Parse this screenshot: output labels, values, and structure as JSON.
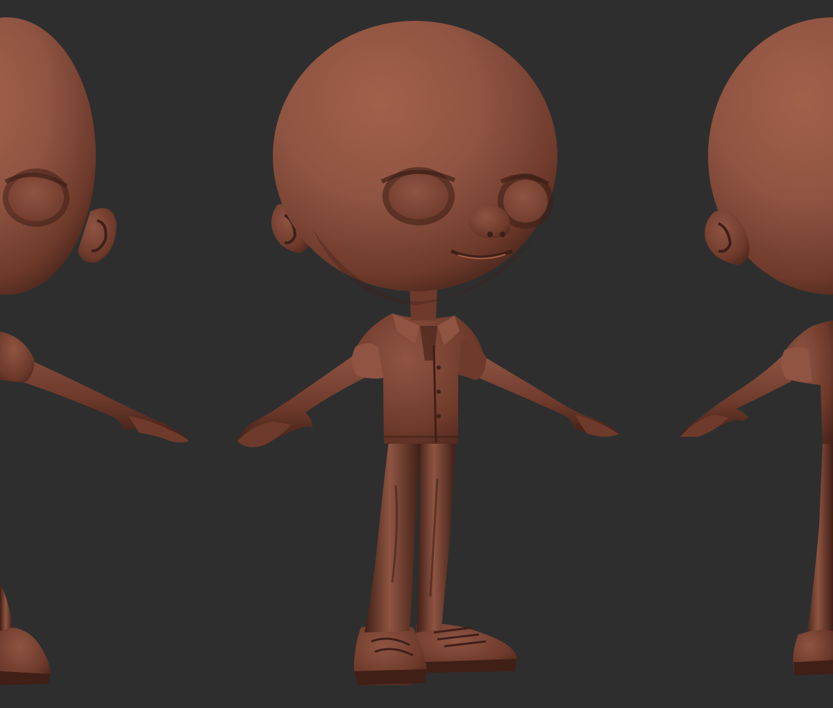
{
  "colors": {
    "background": "#2e2e2e",
    "clay": "#6e3a2b",
    "clay_light": "#8f5442",
    "clay_dark": "#3f1f16",
    "clay_highlight": "#a3604b"
  },
  "views": [
    {
      "name": "right-side-view"
    },
    {
      "name": "front-three-quarter-view"
    },
    {
      "name": "back-three-quarter-view"
    }
  ]
}
